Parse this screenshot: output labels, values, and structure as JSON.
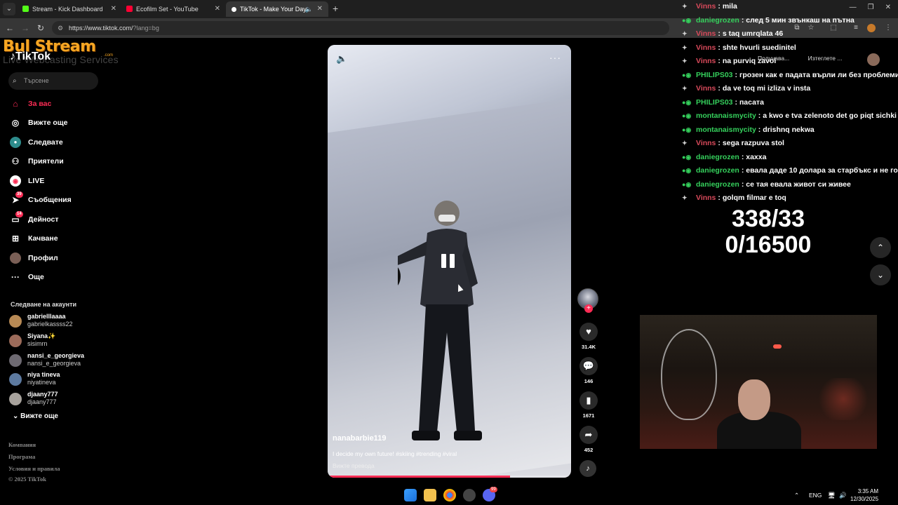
{
  "browser": {
    "tabs": [
      {
        "label": "Stream - Kick Dashboard",
        "color": "#53fc18"
      },
      {
        "label": "Ecofilm Set - YouTube",
        "color": "#ff0033"
      },
      {
        "label": "TikTok - Make Your Day",
        "color": "#ffffff"
      }
    ],
    "url": "https://www.tiktok.com/",
    "url_query": "?lang=bg"
  },
  "watermark": {
    "brand": "Bul Stream",
    "dotcom": ".com",
    "tagline": "Live Webcasting Services"
  },
  "tiktok": {
    "brand": "TikTok",
    "search_placeholder": "Търсене",
    "nav": [
      {
        "label": "За вас",
        "icon": "home-icon"
      },
      {
        "label": "Вижте още",
        "icon": "compass-icon"
      },
      {
        "label": "Следвате",
        "icon": "following-icon"
      },
      {
        "label": "Приятели",
        "icon": "friends-icon"
      },
      {
        "label": "LIVE",
        "icon": "live-icon"
      },
      {
        "label": "Съобщения",
        "icon": "messages-icon",
        "badge": "39"
      },
      {
        "label": "Дейност",
        "icon": "activity-icon",
        "badge": "14"
      },
      {
        "label": "Качване",
        "icon": "upload-icon"
      },
      {
        "label": "Профил",
        "icon": "profile-icon"
      },
      {
        "label": "Още",
        "icon": "more-icon"
      }
    ],
    "following_title": "Следване на акаунти",
    "accounts": [
      {
        "name": "gabrielllaaaa",
        "handle": "gabrielkassss22"
      },
      {
        "name": "Siyana✨",
        "handle": "sisimrn"
      },
      {
        "name": "nansi_e_georgieva",
        "handle": "nansi_e_georgieva"
      },
      {
        "name": "niya tineva",
        "handle": "niyatineva"
      },
      {
        "name": "djaany777",
        "handle": "djaany777"
      }
    ],
    "see_more": "Вижте още",
    "footer": [
      "Компания",
      "Програма",
      "Условия и правила",
      "© 2025 TikTok"
    ],
    "top_actions": [
      "Получава...",
      "Изтеглете ..."
    ],
    "video": {
      "author": "nanabarbie119",
      "caption": "I decide my own future! #skiing #trending #viral",
      "translate": "Вижте превода",
      "progress": 0.75
    },
    "actions": [
      {
        "icon": "heart-icon",
        "count": "31.4K"
      },
      {
        "icon": "comment-icon",
        "count": "146"
      },
      {
        "icon": "bookmark-icon",
        "count": "1671"
      },
      {
        "icon": "share-icon",
        "count": "452"
      }
    ]
  },
  "chat": [
    {
      "user": "Vinns",
      "color": "red",
      "msg": ": mila"
    },
    {
      "user": "daniegrozen",
      "color": "green",
      "msg": ": след 5 мин звънкаш на пътна"
    },
    {
      "user": "Vinns",
      "color": "red",
      "msg": ": s taq umrqlata 46"
    },
    {
      "user": "Vinns",
      "color": "red",
      "msg": ": shte hvurli suedinitel"
    },
    {
      "user": "Vinns",
      "color": "red",
      "msg": ": na purviq zavoi"
    },
    {
      "user": "PHILIPS03",
      "color": "green",
      "msg": ": грозен как е падата върли ли без проблеми"
    },
    {
      "user": "Vinns",
      "color": "red",
      "msg": ": da ve toq mi izliza v insta"
    },
    {
      "user": "PHILIPS03",
      "color": "green",
      "msg": ": пасата"
    },
    {
      "user": "montanaismycity",
      "color": "green",
      "msg": ": a kwo e tva zelenoto det go piqt sichki"
    },
    {
      "user": "montanaismycity",
      "color": "green",
      "msg": ": drishnq nekwa"
    },
    {
      "user": "Vinns",
      "color": "red",
      "msg": ": sega razpuva stol"
    },
    {
      "user": "daniegrozen",
      "color": "green",
      "msg": ": хахха"
    },
    {
      "user": "daniegrozen",
      "color": "green",
      "msg": ": евала даде 10 долара за старбъкс и не го г"
    },
    {
      "user": "daniegrozen",
      "color": "green",
      "msg": ": се тая евала живот си живее"
    },
    {
      "user": "Vinns",
      "color": "red",
      "msg": ": golqm filmar e toq"
    }
  ],
  "counter": {
    "line1": "338/33",
    "line2": "0/16500"
  },
  "taskbar": {
    "lang": "ENG",
    "time": "3:35 AM",
    "date": "12/30/2025",
    "discord_badge": "99"
  }
}
